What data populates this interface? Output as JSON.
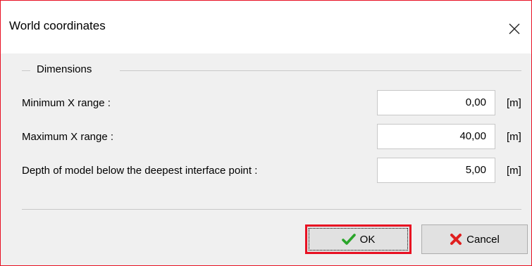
{
  "window": {
    "title": "World coordinates",
    "close_icon": "close-icon"
  },
  "dimensions": {
    "group_label": "Dimensions",
    "rows": [
      {
        "label": "Minimum X range :",
        "value": "0,00",
        "unit": "[m]"
      },
      {
        "label": "Maximum X range :",
        "value": "40,00",
        "unit": "[m]"
      },
      {
        "label": "Depth of model below the deepest interface point :",
        "value": "5,00",
        "unit": "[m]"
      }
    ]
  },
  "buttons": {
    "ok_label": "OK",
    "ok_icon": "checkmark-icon",
    "cancel_label": "Cancel",
    "cancel_icon": "x-icon"
  },
  "colors": {
    "highlight_red": "#e81123",
    "check_green": "#2aa52a",
    "cancel_red": "#e01f1f"
  }
}
